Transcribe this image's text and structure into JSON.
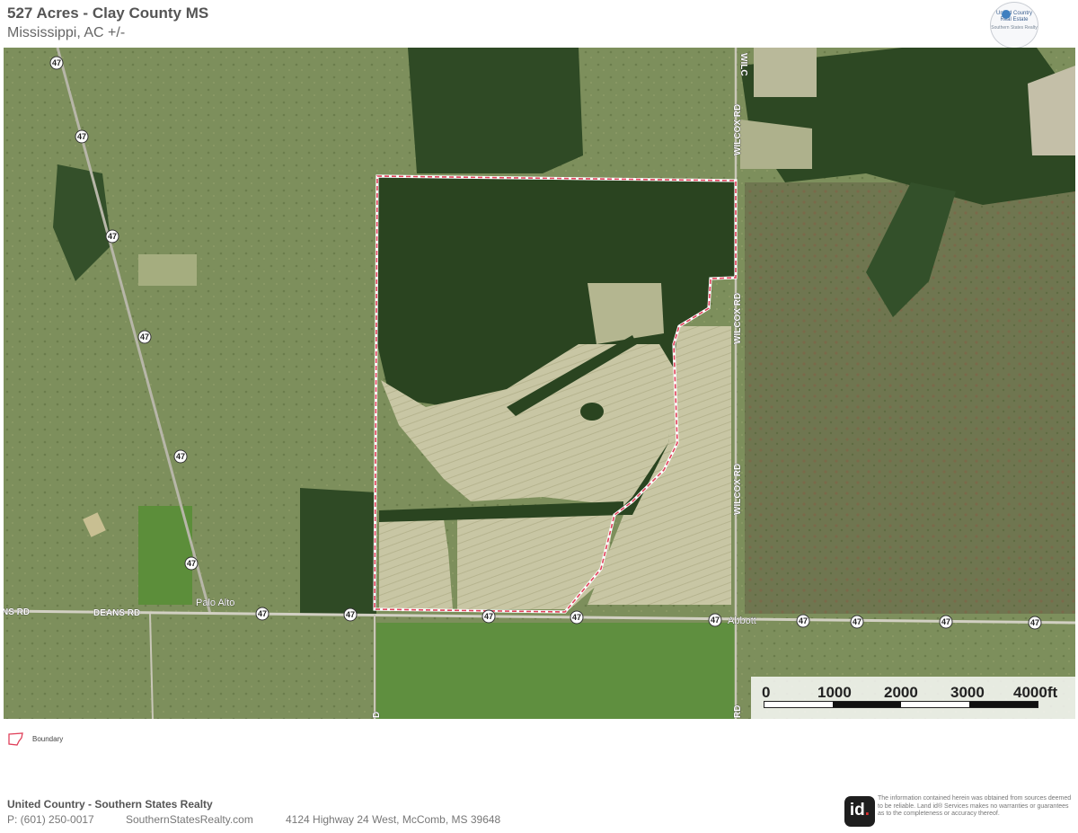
{
  "header": {
    "title": "527 Acres - Clay County MS",
    "subtitle": "Mississippi,  AC +/-"
  },
  "logo": {
    "line1": "United Country Real Estate",
    "line2": "Southern States Realty"
  },
  "map": {
    "road_labels": {
      "deans_rd_left": "NS RD",
      "deans_rd": "DEANS RD",
      "wilcox_rd_top": "WILCOX RD",
      "wilcox_rd_mid": "WILCOX RD",
      "wilcox_rd_low": "WILCOX RD",
      "wilcox_rd_top_edge": "WILC",
      "rd_bottom_right": "RD",
      "rd_bottom_left": "D"
    },
    "place_labels": {
      "palo_alto": "Palo Alto",
      "abbott": "Abbott"
    },
    "highway_number": "47",
    "boundary_color": "#e0405a"
  },
  "scale": {
    "labels": [
      "0",
      "1000",
      "2000",
      "3000",
      "4000ft"
    ]
  },
  "legend": {
    "boundary_label": "Boundary"
  },
  "footer": {
    "company": "United Country - Southern States Realty",
    "phone": "P: (601) 250-0017",
    "website": "SouthernStatesRealty.com",
    "address": "4124 Highway 24 West, McComb, MS 39648",
    "badge": "id",
    "disclaimer": "The information contained herein was obtained from sources deemed to be reliable. Land id® Services makes no warranties or guarantees as to the completeness or accuracy thereof."
  }
}
